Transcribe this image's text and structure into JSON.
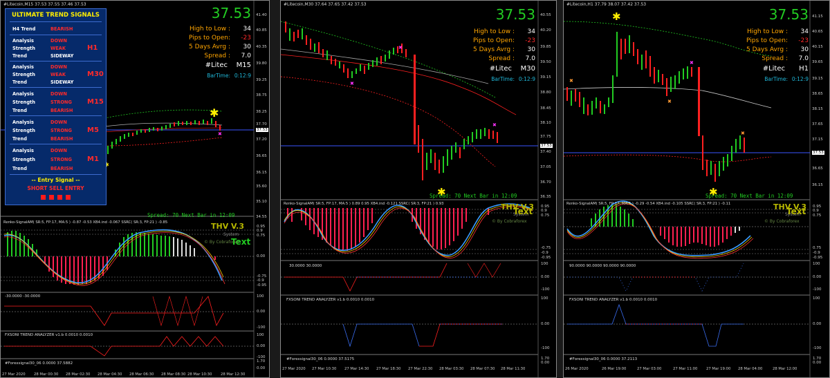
{
  "windows": [
    {
      "id": "m15",
      "title": "#Litecoin,M15  37.53 37.55 37.46 37.53",
      "price": "37.53",
      "hl_label": "High to Low  :",
      "hl_val": "34",
      "pto_label": "Pips to Open:",
      "pto_val": "-23",
      "dav_label": "5 Days Avrg  :",
      "dav_val": "30",
      "spr_label": "Spread   :",
      "spr_val": "7.0",
      "sym": "#Litec",
      "tf": "M15",
      "bartime_label": "BarTime:",
      "bartime_val": "0:12:9",
      "price_axis": [
        "41.40",
        "40.85",
        "40.35",
        "39.80",
        "39.25",
        "38.75",
        "38.25",
        "37.70",
        "37.53",
        "37.20",
        "36.65",
        "36.15",
        "35.60",
        "35.10",
        "34.55"
      ],
      "spread_line": "Spread: 70  Next Bar in 12:09",
      "renko_label": "Renko-SignalAM( SR:5, FP:17, MA:5 ) -0.87 -0.53 XB4.ind -0.067  SSRC( SR:3, FP:21 ) -0.85",
      "thv": "THV V.3",
      "system": "System",
      "text": "Text",
      "by": "© By Cobraforex",
      "ind_axis": [
        "0.95",
        "0.9",
        "0.75",
        "0.00",
        "-0.75",
        "-0.9",
        "-0.95"
      ],
      "p3_label": "-30.0000 -30.0000",
      "p3_axis": [
        "100",
        "0.00",
        "-100"
      ],
      "p4_label": "FXSONI TREND ANALYZER v1.b 0.0010 0.0010",
      "p4_axis": [
        "100",
        "0.00",
        "-100"
      ],
      "p5_label": "#Forexsignal30_06 0.0000 37.5882",
      "p5_axis": [
        "1.70",
        "0.00"
      ],
      "time_axis": [
        "27 Mar 2020",
        "28 Mar 00:30",
        "28 Mar 02:30",
        "28 Mar 04:30",
        "28 Mar 06:30",
        "28 Mar 08:30",
        "28 Mar 10:30",
        "28 Mar 12:30"
      ]
    },
    {
      "id": "m30",
      "title": "#Litecoin,M30  37.64 37.65 37.42 37.53",
      "price": "37.53",
      "hl_label": "High to Low  :",
      "hl_val": "34",
      "pto_label": "Pips to Open:",
      "pto_val": "-23",
      "dav_label": "5 Days Avrg  :",
      "dav_val": "30",
      "spr_label": "Spread   :",
      "spr_val": "7.0",
      "sym": "#Litec",
      "tf": "M30",
      "bartime_label": "BarTime:",
      "bartime_val": "0:12:9",
      "price_axis": [
        "40.55",
        "40.20",
        "39.85",
        "39.50",
        "39.15",
        "38.80",
        "38.45",
        "38.10",
        "37.75",
        "37.53",
        "37.40",
        "37.05",
        "36.70",
        "36.35"
      ],
      "spread_line": "Spread: 70  Next Bar in 12:09",
      "renko_label": "Renko-SignalAM( SR:5, FP:17, MA:5 ) 0.89 0.95 XB4.ind -0.121  SSRC( SR:3, FP:21 ) 0.93",
      "thv": "THV V.3",
      "system": "System",
      "text": "Text",
      "by": "© By Cobraforex",
      "ind_axis": [
        "0.95",
        "0.9",
        "0.75",
        "-0.75",
        "-0.9",
        "-0.95"
      ],
      "p3_label": "30.0000 30.0000",
      "p3_axis": [
        "100",
        "0.00",
        "-100"
      ],
      "p4_label": "FXSONI TREND ANALYZER v1.b 0.0010 0.0010",
      "p4_axis": [
        "100",
        "0.00",
        "-100"
      ],
      "p5_label": "#Forexsignal30_06 0.0000 37.5175",
      "p5_axis": [
        "1.70",
        "0.00"
      ],
      "time_axis": [
        "27 Mar 2020",
        "27 Mar 10:30",
        "27 Mar 14:30",
        "27 Mar 18:30",
        "27 Mar 22:30",
        "28 Mar 03:30",
        "28 Mar 07:30",
        "28 Mar 11:30"
      ]
    },
    {
      "id": "h1",
      "title": "#Litecoin,H1  37.79 38.07 37.42 37.53",
      "price": "37.53",
      "hl_label": "High to Low  :",
      "hl_val": "34",
      "pto_label": "Pips to Open:",
      "pto_val": "-23",
      "dav_label": "5 Days Avrg  :",
      "dav_val": "30",
      "spr_label": "Spread   :",
      "spr_val": "7.0",
      "sym": "#Litec",
      "tf": "H1",
      "bartime_label": "BarTime:",
      "bartime_val": "0:12:9",
      "price_axis": [
        "41.15",
        "40.65",
        "40.15",
        "39.65",
        "39.15",
        "38.65",
        "38.15",
        "37.65",
        "37.53",
        "37.15",
        "36.65",
        "36.15"
      ],
      "spread_line": "Spread: 70  Next Bar in 12:09",
      "renko_label": "Renko-SignalAM( SR:5, FP:17, MA:5 ) -0.29 -0.54 XB4.ind -0.105  SSRC( SR:3, FP:21 ) -0.11",
      "thv": "THV V.3",
      "system": "System",
      "text": "Text",
      "by": "© By Cobraforex",
      "ind_axis": [
        "0.95",
        "0.9",
        "0.75",
        "0.75",
        "-0.9",
        "-0.95"
      ],
      "p3_label": "90.0000 90.0000 90.0000 90.0000",
      "p3_axis": [
        "100",
        "0.00",
        "-100"
      ],
      "p4_label": "FXSONI TREND ANALYZER v1.b 0.0010 0.0010",
      "p4_axis": [
        "100",
        "0.00",
        "-100"
      ],
      "p5_label": "#Forexsignal30_06 0.0000 37.2113",
      "p5_axis": [
        "1.70",
        "0.00"
      ],
      "time_axis": [
        "26 Mar 2020",
        "26 Mar 19:00",
        "27 Mar 03:00",
        "27 Mar 11:00",
        "27 Mar 19:00",
        "28 Mar 04:00",
        "28 Mar 12:00"
      ]
    }
  ],
  "signals": {
    "title": "ULTIMATE TREND SIGNALS",
    "h4": {
      "label": "H4 Trend",
      "value": "BEARISH"
    },
    "blocks": [
      {
        "tf": "H1",
        "rows": [
          {
            "label": "Analysis",
            "value": "DOWN"
          },
          {
            "label": "Strength",
            "value": "WEAK"
          },
          {
            "label": "Trend",
            "value": "SIDEWAY"
          }
        ]
      },
      {
        "tf": "M30",
        "rows": [
          {
            "label": "Analysis",
            "value": "DOWN"
          },
          {
            "label": "Strength",
            "value": "WEAK"
          },
          {
            "label": "Trend",
            "value": "SIDEWAY"
          }
        ]
      },
      {
        "tf": "M15",
        "rows": [
          {
            "label": "Analysis",
            "value": "DOWN"
          },
          {
            "label": "Strength",
            "value": "STRONG"
          },
          {
            "label": "Trend",
            "value": "BEARISH"
          }
        ]
      },
      {
        "tf": "M5",
        "rows": [
          {
            "label": "Analysis",
            "value": "DOWN"
          },
          {
            "label": "Strength",
            "value": "STRONG"
          },
          {
            "label": "Trend",
            "value": "BEARISH"
          }
        ]
      },
      {
        "tf": "M1",
        "rows": [
          {
            "label": "Analysis",
            "value": "DOWN"
          },
          {
            "label": "Strength",
            "value": "STRONG"
          },
          {
            "label": "Trend",
            "value": "BEARISH"
          }
        ]
      }
    ],
    "entry_title": "-- Entry Signal --",
    "entry_value": "SHORT SELL ENTRY"
  },
  "colors": {
    "bull": "#22cc22",
    "bear": "#ff2020",
    "accent": "#ffee00",
    "blue": "#3a6df0",
    "cyan": "#20b7d8",
    "orange": "#ffa500"
  }
}
